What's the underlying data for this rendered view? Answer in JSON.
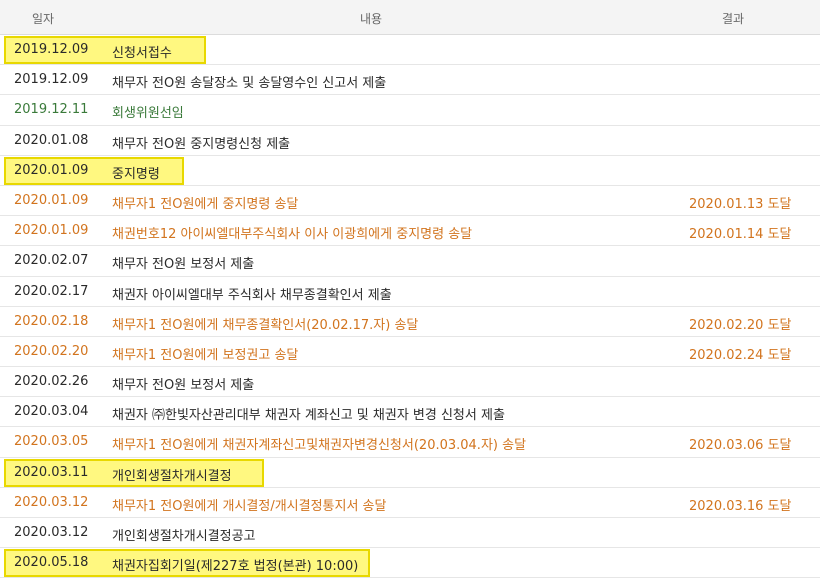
{
  "header": {
    "date": "일자",
    "content": "내용",
    "result": "결과"
  },
  "rows": [
    {
      "date": "2019.12.09",
      "content": "신청서접수",
      "result": ""
    },
    {
      "date": "2019.12.09",
      "content": "채무자 전O원 송달장소 및 송달영수인 신고서 제출",
      "result": ""
    },
    {
      "date": "2019.12.11",
      "content": "회생위원선임",
      "result": ""
    },
    {
      "date": "2020.01.08",
      "content": "채무자 전O원 중지명령신청 제출",
      "result": ""
    },
    {
      "date": "2020.01.09",
      "content": "중지명령",
      "result": ""
    },
    {
      "date": "2020.01.09",
      "content": "채무자1 전O원에게 중지명령 송달",
      "result": "2020.01.13 도달"
    },
    {
      "date": "2020.01.09",
      "content": "채권번호12 아이씨엘대부주식회사 이사 이광희에게 중지명령 송달",
      "result": "2020.01.14 도달"
    },
    {
      "date": "2020.02.07",
      "content": "채무자 전O원 보정서 제출",
      "result": ""
    },
    {
      "date": "2020.02.17",
      "content": "채권자 아이씨엘대부 주식회사 채무종결확인서 제출",
      "result": ""
    },
    {
      "date": "2020.02.18",
      "content": "채무자1 전O원에게 채무종결확인서(20.02.17.자) 송달",
      "result": "2020.02.20 도달"
    },
    {
      "date": "2020.02.20",
      "content": "채무자1 전O원에게 보정권고 송달",
      "result": "2020.02.24 도달"
    },
    {
      "date": "2020.02.26",
      "content": "채무자 전O원 보정서 제출",
      "result": ""
    },
    {
      "date": "2020.03.04",
      "content": "채권자 ㈜한빛자산관리대부 채권자 계좌신고 및 채권자 변경 신청서 제출",
      "result": ""
    },
    {
      "date": "2020.03.05",
      "content": "채무자1 전O원에게 채권자계좌신고및채권자변경신청서(20.03.04.자) 송달",
      "result": "2020.03.06 도달"
    },
    {
      "date": "2020.03.11",
      "content": "개인회생절차개시결정",
      "result": ""
    },
    {
      "date": "2020.03.12",
      "content": "채무자1 전O원에게 개시결정/개시결정통지서 송달",
      "result": "2020.03.16 도달"
    },
    {
      "date": "2020.03.12",
      "content": "개인회생절차개시결정공고",
      "result": ""
    },
    {
      "date": "2020.05.18",
      "content": "채권자집회기일(제227호 법정(본관) 10:00)",
      "result": ""
    }
  ],
  "colors": {
    "black": "#2a2a2a",
    "green": "#3a7a3a",
    "orange": "#d2741e",
    "highlight": "#fff53c"
  }
}
